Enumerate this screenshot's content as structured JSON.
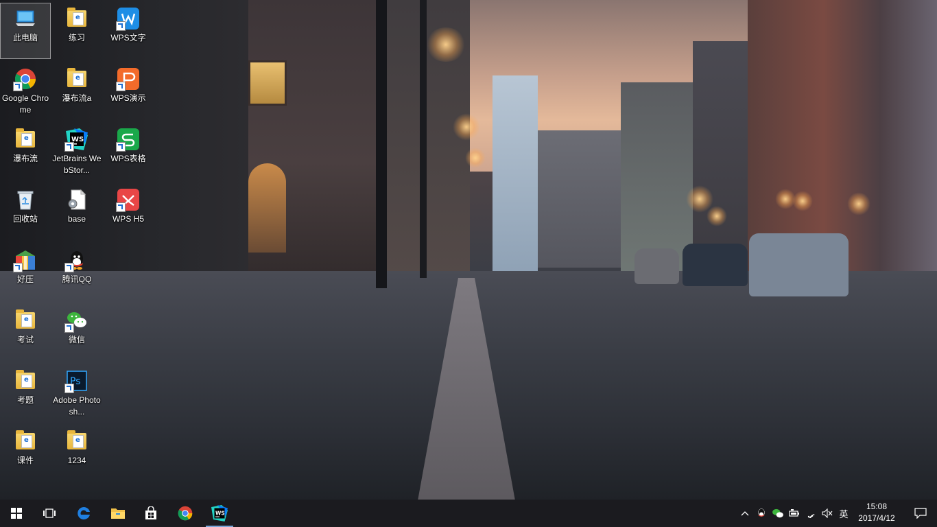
{
  "desktop": {
    "icons": [
      {
        "label": "此电脑",
        "icon": "this-pc-icon"
      },
      {
        "label": "练习",
        "icon": "folder-icon"
      },
      {
        "label": "WPS文字",
        "icon": "wps-writer-icon"
      },
      {
        "label": "Google Chrome",
        "icon": "chrome-icon"
      },
      {
        "label": "瀑布流a",
        "icon": "folder-icon"
      },
      {
        "label": "WPS演示",
        "icon": "wps-presentation-icon"
      },
      {
        "label": "瀑布流",
        "icon": "folder-icon"
      },
      {
        "label": "JetBrains WebStor...",
        "icon": "webstorm-icon"
      },
      {
        "label": "WPS表格",
        "icon": "wps-spreadsheet-icon"
      },
      {
        "label": "回收站",
        "icon": "recycle-bin-icon"
      },
      {
        "label": "base",
        "icon": "file-icon"
      },
      {
        "label": "WPS H5",
        "icon": "wps-h5-icon"
      },
      {
        "label": "好压",
        "icon": "haozip-icon"
      },
      {
        "label": "腾讯QQ",
        "icon": "qq-icon"
      },
      {
        "label": "考试",
        "icon": "folder-icon"
      },
      {
        "label": "微信",
        "icon": "wechat-icon"
      },
      {
        "label": "考题",
        "icon": "folder-icon"
      },
      {
        "label": "Adobe Photosh...",
        "icon": "photoshop-icon"
      },
      {
        "label": "课件",
        "icon": "folder-icon"
      },
      {
        "label": "1234",
        "icon": "folder-icon"
      }
    ]
  },
  "taskbar": {
    "pinned": [
      {
        "name": "start",
        "icon": "windows-start-icon"
      },
      {
        "name": "task-view",
        "icon": "task-view-icon"
      },
      {
        "name": "edge",
        "icon": "edge-icon"
      },
      {
        "name": "file-explorer",
        "icon": "folder-icon"
      },
      {
        "name": "store",
        "icon": "store-icon"
      },
      {
        "name": "chrome",
        "icon": "chrome-icon"
      },
      {
        "name": "webstorm",
        "icon": "webstorm-icon"
      }
    ],
    "tray": {
      "ime": "英",
      "time": "15:08",
      "date": "2017/4/12"
    }
  },
  "colors": {
    "taskbar_bg": "#121216",
    "accent": "#7aa6d8",
    "wps_writer": "#1e8ee6",
    "wps_presentation": "#f36b2a",
    "wps_spreadsheet": "#1aa84a",
    "wps_h5": "#e94646"
  }
}
